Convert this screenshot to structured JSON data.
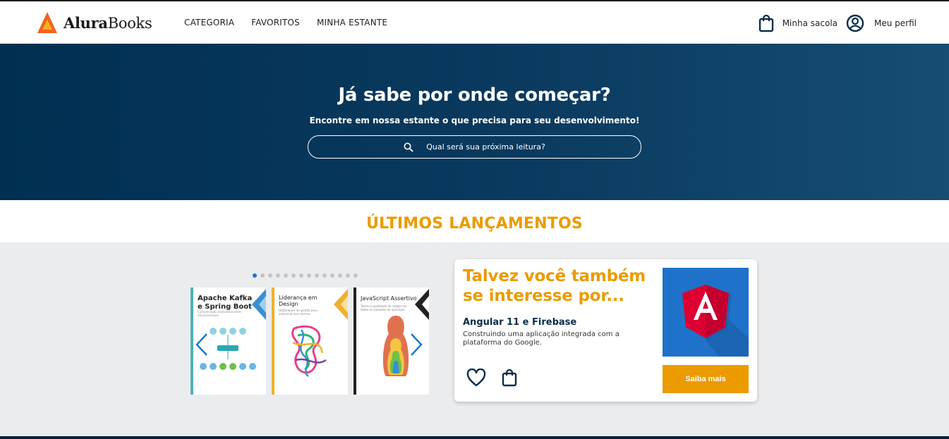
{
  "brand": {
    "bold": "Alura",
    "regular": "Books"
  },
  "nav": {
    "items": [
      "CATEGORIA",
      "FAVORITOS",
      "MINHA ESTANTE"
    ]
  },
  "actions": {
    "bag_label": "Minha sacola",
    "profile_label": "Meu perfil"
  },
  "hero": {
    "title": "Já sabe por onde começar?",
    "subtitle": "Encontre em nossa estante o que precisa para seu desenvolvimento!",
    "search_placeholder": "Qual será sua próxima leitura?"
  },
  "releases": {
    "title": "ÚLTIMOS LANÇAMENTOS",
    "dots_count": 14,
    "active_dot": 0,
    "books": [
      {
        "title": "Apache Kafka e Spring Boot",
        "subtitle": "Comunicação assíncrona entre microsserviços",
        "accent": "#3a8fd1"
      },
      {
        "title": "Liderança em Design",
        "subtitle": "Habilidades de gestão para alavancar sua carreira",
        "accent": "#f0b030"
      },
      {
        "title": "JavaScript Assertivo",
        "subtitle": "Testes e qualidade de código em todas as camadas da aplicação",
        "accent": "#222222"
      }
    ]
  },
  "recommendation": {
    "title": "Talvez você também se interesse por...",
    "book_title": "Angular 11 e Firebase",
    "book_desc": "Construindo uma aplicação integrada com a plataforma do Google.",
    "button_label": "Saiba mais"
  },
  "colors": {
    "accent": "#eb9b00",
    "navy": "#002f52",
    "link_blue": "#1976d2"
  }
}
